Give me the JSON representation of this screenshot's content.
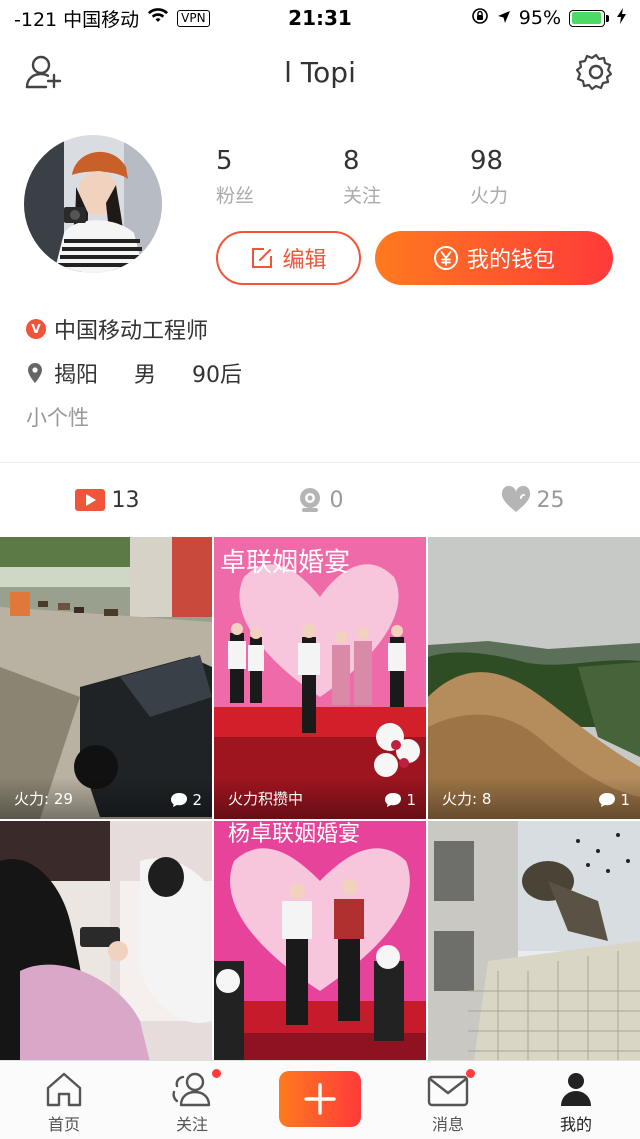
{
  "status_bar": {
    "carrier": "-121 中国移动",
    "vpn": "VPN",
    "time": "21:31",
    "battery": "95%",
    "battery_level": 0.95
  },
  "nav": {
    "title": "l Topi",
    "left_icon": "add-friend-icon",
    "right_icon": "gear-icon"
  },
  "profile": {
    "stats": [
      {
        "value": "5",
        "label": "粉丝"
      },
      {
        "value": "8",
        "label": "关注"
      },
      {
        "value": "98",
        "label": "火力"
      }
    ],
    "edit_label": "编辑",
    "wallet_label": "我的钱包",
    "title": "中国移动工程师",
    "location": "揭阳",
    "gender": "男",
    "age": "90后",
    "bio": "小个性"
  },
  "tabs": [
    {
      "icon": "video-icon",
      "count": "13"
    },
    {
      "icon": "camera-icon",
      "count": "0"
    },
    {
      "icon": "heart-icon",
      "count": "25"
    }
  ],
  "grid": [
    {
      "left": "火力: 29",
      "comments": "2"
    },
    {
      "left": "火力积攒中",
      "comments": "1",
      "banner": "卓联姻婚宴"
    },
    {
      "left": "火力: 8",
      "comments": "1"
    },
    {
      "left": "",
      "comments": ""
    },
    {
      "left": "",
      "comments": "",
      "banner": "杨卓联姻婚宴"
    },
    {
      "left": "",
      "comments": ""
    }
  ],
  "tabbar": [
    {
      "label": "首页",
      "icon": "home-icon"
    },
    {
      "label": "关注",
      "icon": "follow-icon"
    },
    {
      "label": "",
      "icon": "plus-icon"
    },
    {
      "label": "消息",
      "icon": "message-icon"
    },
    {
      "label": "我的",
      "icon": "profile-icon"
    }
  ],
  "colors": {
    "accent": "#f0553a",
    "badge": "#ff3b3b"
  }
}
